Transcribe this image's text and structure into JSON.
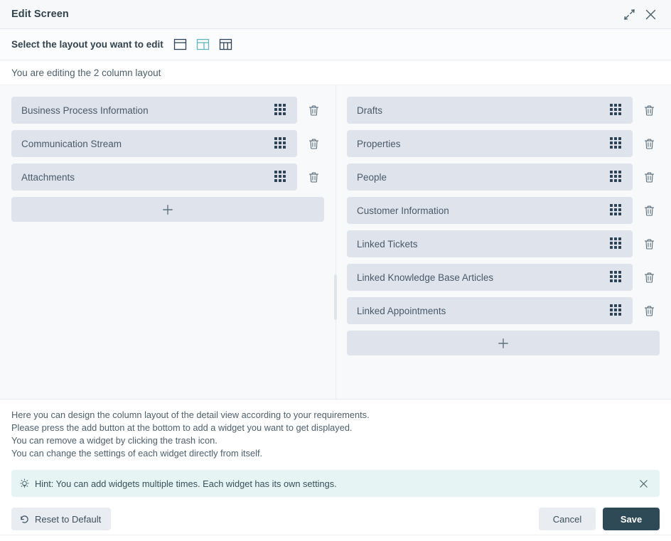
{
  "window": {
    "title": "Edit Screen",
    "minimize_icon": "collapse-arrows-icon",
    "close_icon": "close-icon"
  },
  "layout_selector": {
    "label": "Select the layout you want to edit",
    "options": [
      {
        "name": "one-column-layout",
        "columns": 1,
        "selected": false
      },
      {
        "name": "two-column-layout",
        "columns": 2,
        "selected": true
      },
      {
        "name": "three-column-layout",
        "columns": 3,
        "selected": false
      }
    ],
    "selected_color": "#5fb4bd",
    "unselected_color": "#2f4356"
  },
  "subheader": {
    "text": "You are editing the 2 column layout"
  },
  "columns": {
    "left": {
      "widgets": [
        {
          "label": "Business Process Information"
        },
        {
          "label": "Communication Stream"
        },
        {
          "label": "Attachments"
        }
      ],
      "add_label": "+"
    },
    "right": {
      "widgets": [
        {
          "label": "Drafts"
        },
        {
          "label": "Properties"
        },
        {
          "label": "People"
        },
        {
          "label": "Customer Information"
        },
        {
          "label": "Linked Tickets"
        },
        {
          "label": "Linked Knowledge Base Articles"
        },
        {
          "label": "Linked Appointments"
        }
      ],
      "add_label": "+"
    }
  },
  "description": {
    "line1": "Here you can design the column layout of the detail view according to your requirements.",
    "line2": "Please press the add button at the bottom to add a widget you want to get displayed.",
    "line3": "You can remove a widget by clicking the trash icon.",
    "line4": "You can change the settings of each widget directly from itself."
  },
  "hint": {
    "icon": "lightbulb-icon",
    "text": "Hint: You can add widgets multiple times. Each widget has its own settings.",
    "close_icon": "close-icon",
    "background": "#e7f4f4"
  },
  "footer": {
    "reset_label": "Reset to Default",
    "reset_icon": "undo-icon",
    "cancel_label": "Cancel",
    "save_label": "Save",
    "save_background": "#2e4a57"
  }
}
